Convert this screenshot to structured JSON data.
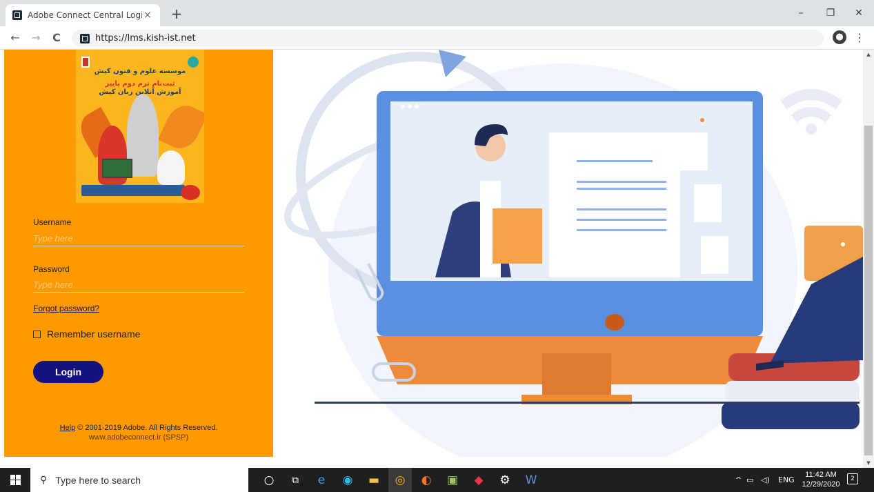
{
  "browser": {
    "tab_title": "Adobe Connect Central Login",
    "tab_close": "×",
    "new_tab": "+",
    "url": "https://lms.kish-ist.net",
    "back": "←",
    "forward": "→",
    "reload": "C",
    "minimize": "–",
    "restore": "❐",
    "close": "✕"
  },
  "banner": {
    "line1": "موسسه علوم و فنون کیش",
    "line2": "ثبت‌نام ترم دوم پاییز",
    "line3": "آموزش آنلاین زبان کیش"
  },
  "login": {
    "username_label": "Username",
    "username_placeholder": "Type here",
    "password_label": "Password",
    "password_placeholder": "Type here",
    "forgot": "Forgot password?",
    "remember": "Remember username",
    "login_button": "Login"
  },
  "footer": {
    "help": "Help",
    "copyright": " © 2001-2019 Adobe. All Rights Reserved.",
    "site": "www.adobeconnect.ir (SPSP)"
  },
  "taskbar": {
    "search_placeholder": "Type here to search",
    "language": "ENG",
    "time": "11:42 AM",
    "date": "12/29/2020",
    "notifications": "2"
  },
  "colors": {
    "panel": "#fe9900",
    "login_button": "#14127e",
    "monitor_frame": "#5b8fe0",
    "monitor_base": "#ee8b3a"
  }
}
